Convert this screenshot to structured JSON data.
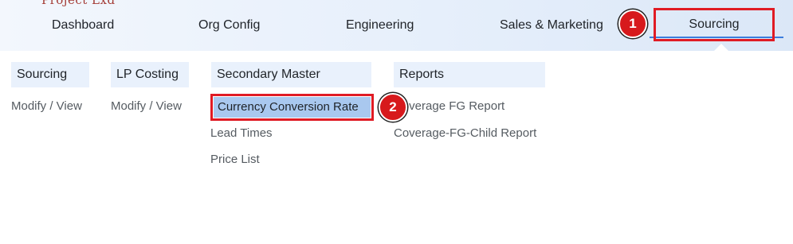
{
  "header": {
    "logo_text": "Project Lxd",
    "nav": [
      {
        "label": "Dashboard"
      },
      {
        "label": "Org Config"
      },
      {
        "label": "Engineering"
      },
      {
        "label": "Sales & Marketing"
      },
      {
        "label": "Sourcing",
        "active": true
      }
    ]
  },
  "badges": {
    "one": "1",
    "two": "2"
  },
  "menu": {
    "columns": [
      {
        "header": "Sourcing",
        "links": [
          "Modify / View"
        ]
      },
      {
        "header": "LP Costing",
        "links": [
          "Modify / View"
        ]
      },
      {
        "header": "Secondary Master",
        "links": [
          "Currency Conversion Rate",
          "Lead Times",
          "Price List"
        ]
      },
      {
        "header": "Reports",
        "links": [
          "Coverage FG Report",
          "Coverage-FG-Child Report"
        ]
      }
    ]
  },
  "colors": {
    "highlight_border": "#e01b24",
    "badge": "#d7191c",
    "selected_item_bg": "#a9c8ef",
    "header_bg": "#e9f1fc",
    "active_underline": "#3b7ddd"
  }
}
